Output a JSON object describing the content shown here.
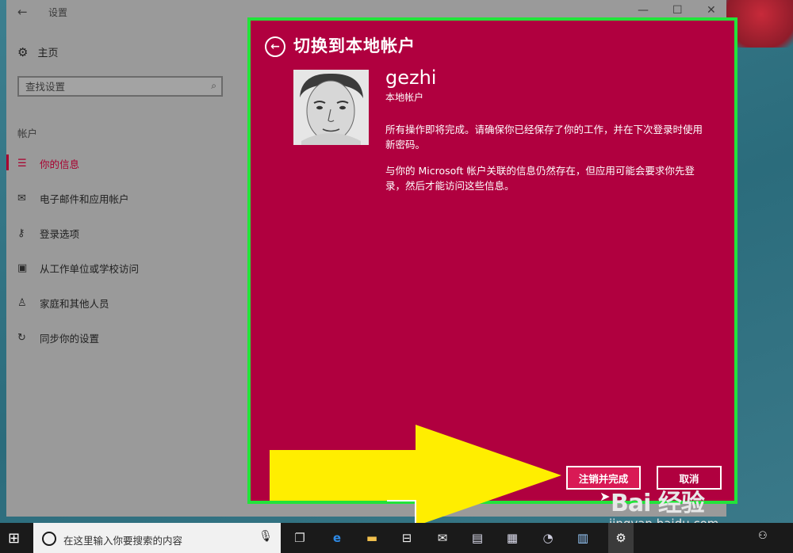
{
  "window": {
    "title": "设置",
    "back_glyph": "←",
    "minimize_glyph": "—",
    "maximize_glyph": "☐",
    "close_glyph": "✕"
  },
  "sidebar": {
    "home_label": "主页",
    "search_placeholder": "查找设置",
    "section_label": "帐户",
    "items": [
      {
        "label": "你的信息",
        "icon": "person-card-icon",
        "active": true
      },
      {
        "label": "电子邮件和应用帐户",
        "icon": "mail-icon",
        "active": false
      },
      {
        "label": "登录选项",
        "icon": "key-icon",
        "active": false
      },
      {
        "label": "从工作单位或学校访问",
        "icon": "briefcase-icon",
        "active": false
      },
      {
        "label": "家庭和其他人员",
        "icon": "people-icon",
        "active": false
      },
      {
        "label": "同步你的设置",
        "icon": "sync-icon",
        "active": false
      }
    ]
  },
  "dialog": {
    "title": "切换到本地帐户",
    "username": "gezhi",
    "account_type": "本地帐户",
    "message1": "所有操作即将完成。请确保你已经保存了你的工作，并在下次登录时使用新密码。",
    "message2": "与你的 Microsoft 帐户关联的信息仍然存在，但应用可能会要求你先登录，然后才能访问这些信息。",
    "primary_button": "注销并完成",
    "cancel_button": "取消"
  },
  "taskbar": {
    "search_placeholder": "在这里输入你要搜索的内容"
  },
  "watermark": {
    "brand": "Bai 经验",
    "url": "jingyan.baidu.com"
  },
  "colors": {
    "dialog_bg": "#b0003f",
    "highlight_border": "#22e33a",
    "accent": "#a8002f",
    "arrow": "#ffee00"
  }
}
